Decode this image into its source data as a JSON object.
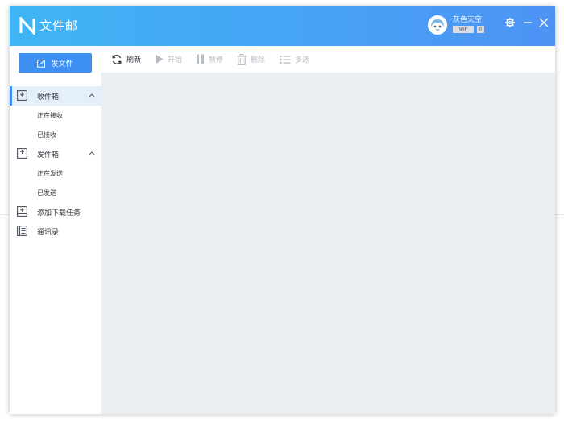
{
  "app": {
    "title": "文件邮"
  },
  "user": {
    "name": "灰色天空",
    "vip_label": "VIP",
    "level_label": "8"
  },
  "sidebar": {
    "send_button_label": "发文件",
    "inbox": {
      "label": "收件箱",
      "children": [
        "正在接收",
        "已接收"
      ]
    },
    "outbox": {
      "label": "发件箱",
      "children": [
        "正在发送",
        "已发送"
      ]
    },
    "add_download": {
      "label": "添加下载任务"
    },
    "contacts": {
      "label": "通讯录"
    }
  },
  "toolbar": {
    "refresh_label": "刷新",
    "start_label": "开始",
    "pause_label": "暂停",
    "delete_label": "删除",
    "multiselect_label": "多选"
  },
  "colors": {
    "title_gradient_start": "#3fb5f5",
    "title_gradient_end": "#4d93f5",
    "accent": "#3d8ff1",
    "active_nav_bg": "#e5eff9",
    "content_bg": "#e9eef3",
    "disabled_text": "#b7bcc3"
  },
  "icons": {
    "logo": "n-logo-icon",
    "settings": "gear-icon",
    "minimize": "minimize-icon",
    "close": "close-icon",
    "send": "edit-icon",
    "inbox": "tray-download-icon",
    "outbox": "tray-upload-icon",
    "add_download": "tray-plus-icon",
    "contacts": "address-book-icon",
    "refresh": "refresh-icon",
    "start": "play-icon",
    "pause": "pause-icon",
    "delete": "trash-icon",
    "multiselect": "list-icon"
  }
}
